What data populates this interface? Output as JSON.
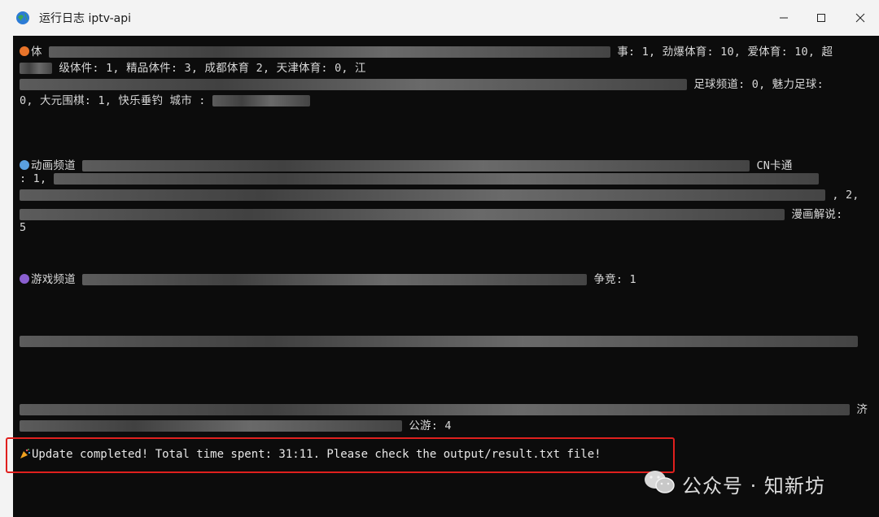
{
  "window": {
    "title": "运行日志 iptv-api",
    "minimize_icon": "minimize-icon",
    "maximize_icon": "maximize-icon",
    "close_icon": "close-icon"
  },
  "console": {
    "lines": [
      {
        "prefix": "体",
        "icon_color": "#e8742a",
        "visible": "事: 1, 劲爆体育: 10, 爱体育: 10, 超"
      },
      {
        "prefix": "",
        "visible": "级体件: 1, 精品体件: 3,  成都体育  2,  天津体育: 0, 江"
      },
      {
        "prefix": "",
        "visible": "足球频道: 0, 魅力足球:"
      },
      {
        "prefix": "",
        "visible": "0, 大元围棋: 1, 快乐垂钓  城市  :"
      },
      {
        "prefix": "动画频道",
        "icon_color": "#5aa0e0",
        "visible": "CN卡通"
      },
      {
        "prefix": "",
        "visible": ": 1,"
      },
      {
        "prefix": "",
        "visible": ", 2,"
      },
      {
        "prefix": "",
        "visible": "漫画解说:"
      },
      {
        "prefix": "",
        "visible": "5"
      },
      {
        "prefix": "游戏频道",
        "icon_color": "#8a5fd0",
        "visible": "争竞: 1"
      },
      {
        "prefix": "",
        "visible": ""
      },
      {
        "prefix": "",
        "visible": "济"
      },
      {
        "prefix": "",
        "visible": "公游: 4"
      }
    ],
    "final_message": "Update completed! Total time spent: 31:11. Please check the output/result.txt file!",
    "final_icon": "party-popper-icon"
  },
  "watermark": {
    "icon": "wechat-icon",
    "text": "公众号 · 知新坊"
  },
  "colors": {
    "console_bg": "#0c0c0c",
    "highlight_border": "#e0201e",
    "text": "#d8d8d8"
  }
}
